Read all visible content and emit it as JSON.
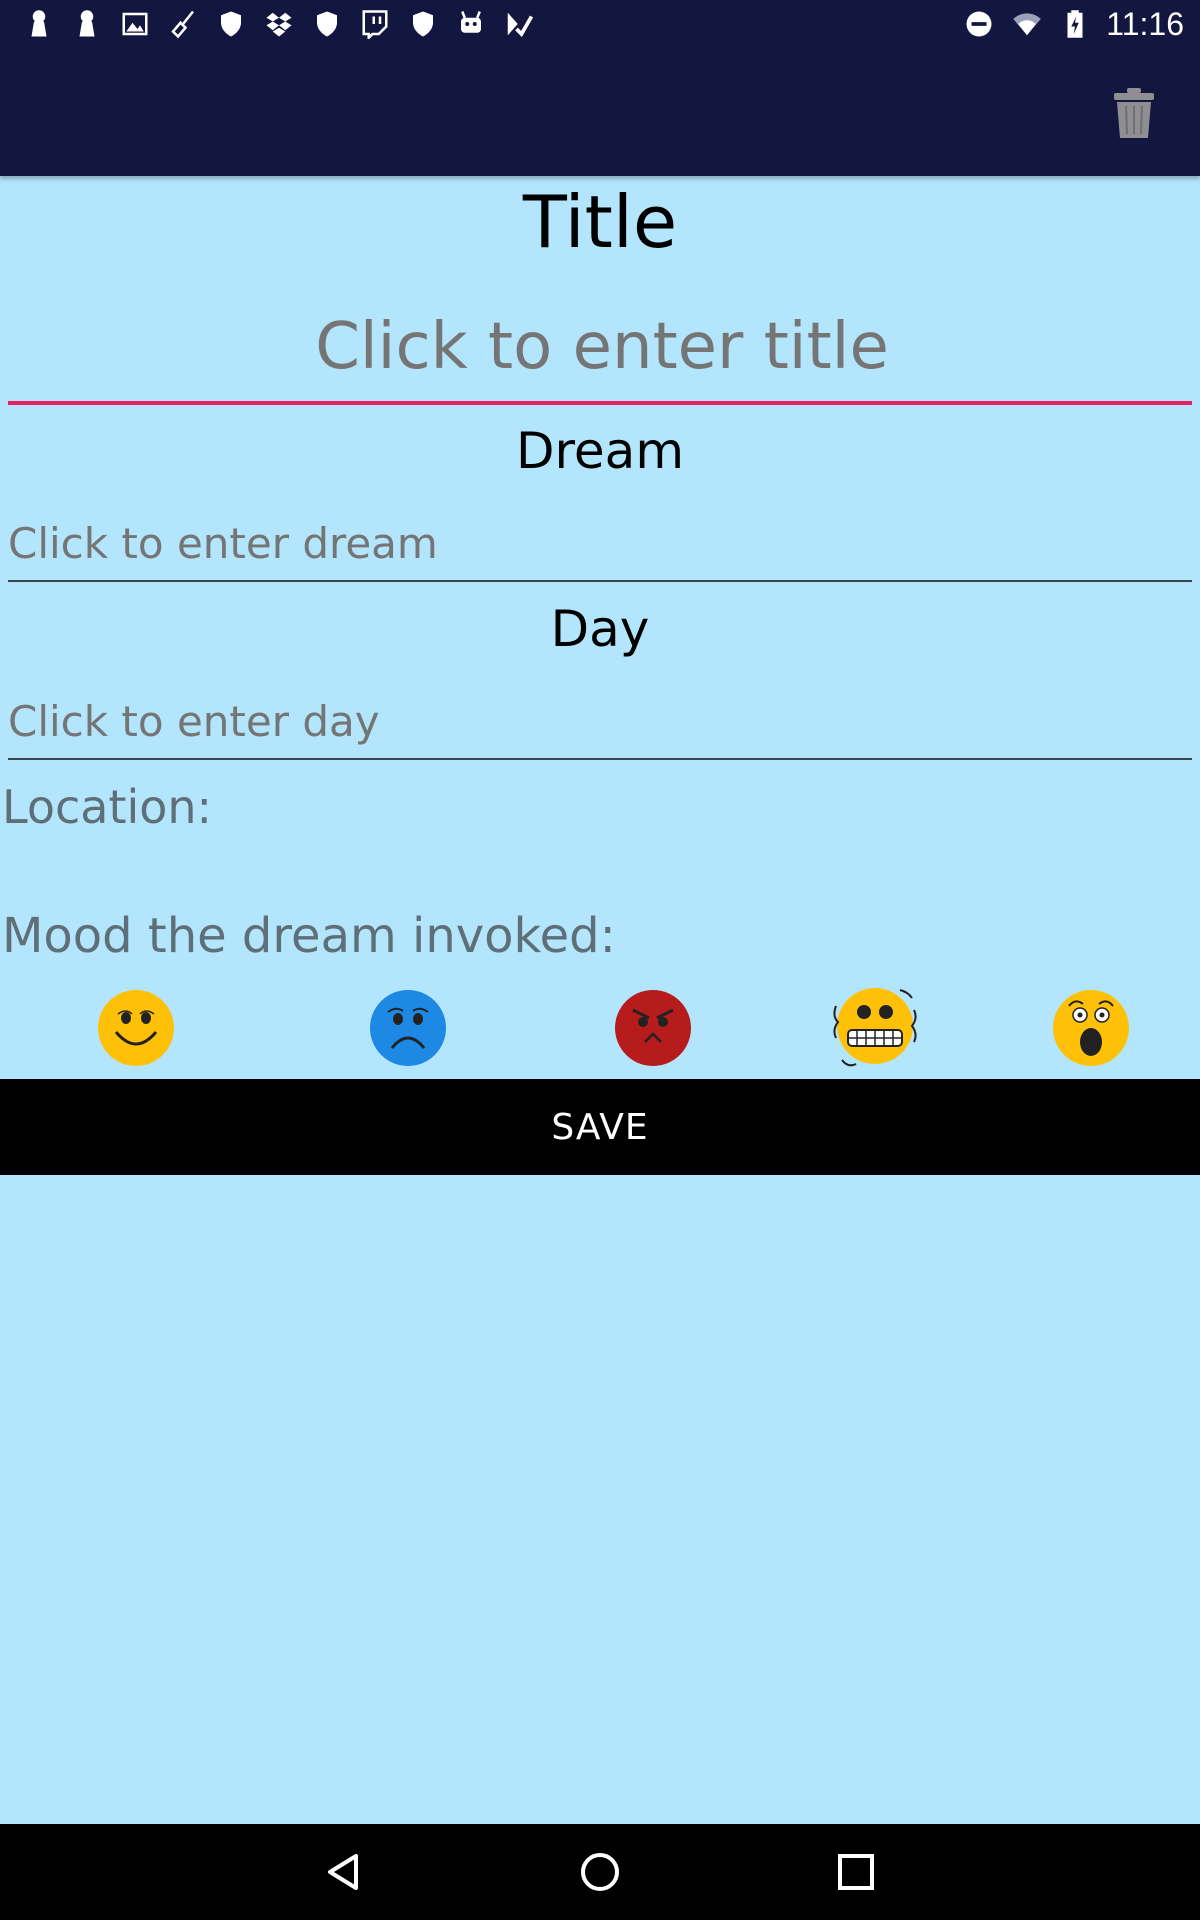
{
  "status_bar": {
    "time": "11:16",
    "icons_left": [
      "keyhole-icon",
      "keyhole-icon",
      "image-icon",
      "broom-icon",
      "shield-icon",
      "dropbox-icon",
      "shield-icon",
      "twitch-icon",
      "shield-icon",
      "android-icon",
      "checkmark-icon"
    ],
    "icons_right": [
      "do-not-disturb-icon",
      "wifi-icon",
      "battery-charging-icon"
    ]
  },
  "app_bar": {
    "delete_icon": "trash-icon",
    "background": "#131740"
  },
  "form": {
    "title_heading": "Title",
    "title_placeholder": "Click to enter title",
    "dream_heading": "Dream",
    "dream_placeholder": "Click to enter dream",
    "day_heading": "Day",
    "day_placeholder": "Click to enter day",
    "location_label": "Location:",
    "mood_label": "Mood the dream invoked:",
    "moods": [
      {
        "name": "happy",
        "color": "#ffc107"
      },
      {
        "name": "sad",
        "color": "#1e88e5"
      },
      {
        "name": "angry",
        "color": "#b71c1c"
      },
      {
        "name": "anxious",
        "color": "#ffc107"
      },
      {
        "name": "scared",
        "color": "#ffc107"
      }
    ],
    "save_label": "SAVE",
    "accent_color": "#e91e63",
    "background": "#b3e5fc"
  },
  "nav_bar": {
    "buttons": [
      "back-icon",
      "home-icon",
      "recents-icon"
    ]
  }
}
